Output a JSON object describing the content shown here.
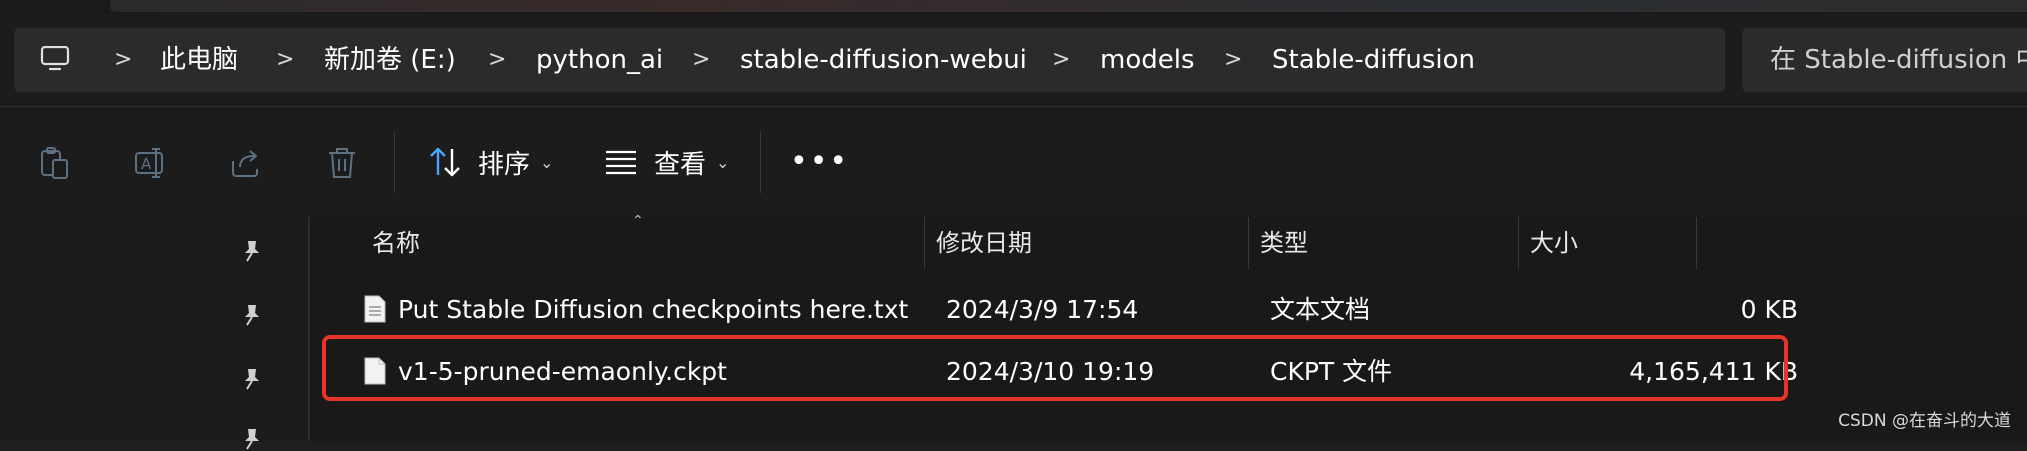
{
  "address_bar": {
    "crumbs": [
      "此电脑",
      "新加卷 (E:)",
      "python_ai",
      "stable-diffusion-webui",
      "models",
      "Stable-diffusion"
    ],
    "separator": ">"
  },
  "search": {
    "placeholder": "在 Stable-diffusion 中搜索"
  },
  "toolbar": {
    "sort_label": "排序",
    "view_label": "查看",
    "more_label": "•••"
  },
  "columns": {
    "name": "名称",
    "modified": "修改日期",
    "type": "类型",
    "size": "大小"
  },
  "files": [
    {
      "name": "Put Stable Diffusion checkpoints here.txt",
      "modified": "2024/3/9 17:54",
      "type": "文本文档",
      "size": "0 KB"
    },
    {
      "name": "v1-5-pruned-emaonly.ckpt",
      "modified": "2024/3/10 19:19",
      "type": "CKPT 文件",
      "size": "4,165,411 KB"
    }
  ],
  "watermark": "CSDN @在奋斗的大道",
  "colors": {
    "highlight": "#e8332a",
    "background": "#1f1f1f",
    "accent": "#4aa3ff"
  }
}
